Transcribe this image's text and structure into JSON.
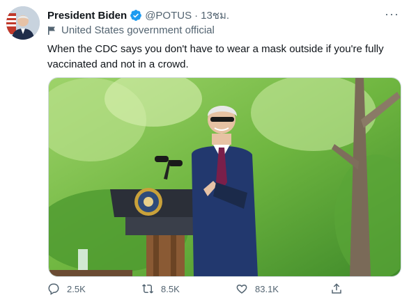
{
  "tweet": {
    "author_name": "President Biden",
    "handle": "@POTUS",
    "separator": "·",
    "time": "13ชม.",
    "label": "United States government official",
    "text": "When the CDC says you don't have to wear a mask outside if you're fully vaccinated and not in a crowd.",
    "more_label": "···"
  },
  "actions": {
    "reply_count": "2.5K",
    "retweet_count": "8.5K",
    "like_count": "83.1K"
  },
  "icons": [
    "avatar",
    "verified-badge-icon",
    "flag-icon",
    "more-icon",
    "reply-icon",
    "retweet-icon",
    "like-icon",
    "share-icon"
  ],
  "colors": {
    "verified": "#1d9bf0",
    "muted": "#536471",
    "text": "#0f1419"
  }
}
